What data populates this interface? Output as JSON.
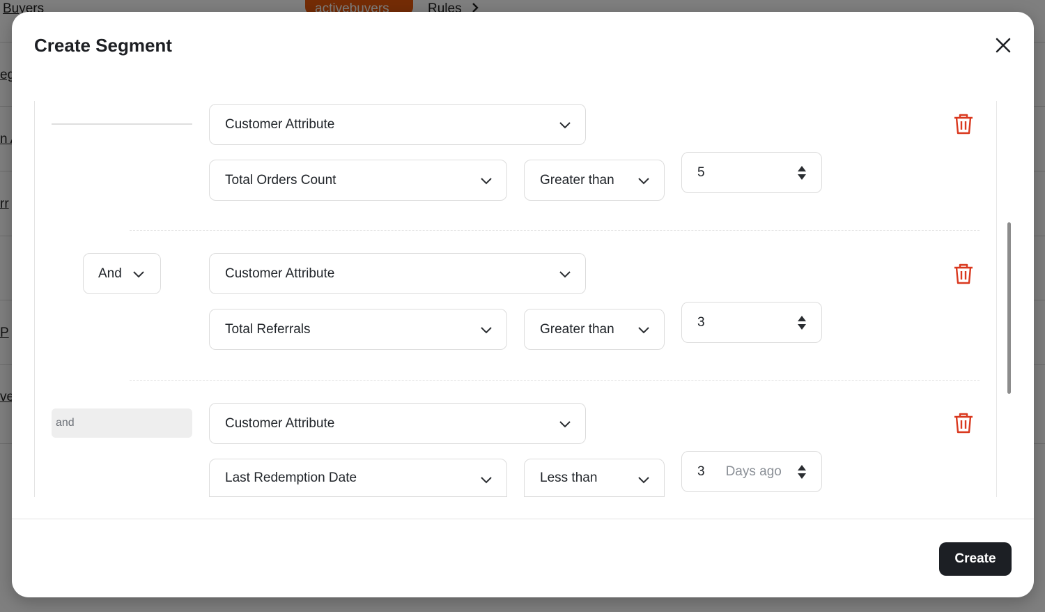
{
  "background": {
    "breadcrumb_left": "Buyers",
    "segment_pill": "activebuyers",
    "rules_label": "Rules",
    "row_fragments": [
      "eg",
      "n A",
      "rr",
      "",
      " P",
      "ve"
    ]
  },
  "modal": {
    "title": "Create Segment",
    "create_label": "Create"
  },
  "rules": [
    {
      "attribute_type": "Customer Attribute",
      "field": "Total Orders Count",
      "operator": "Greater than",
      "value": "5",
      "suffix": ""
    },
    {
      "connector": "And",
      "attribute_type": "Customer Attribute",
      "field": "Total Referrals",
      "operator": "Greater than",
      "value": "3",
      "suffix": ""
    },
    {
      "connector": "and",
      "attribute_type": "Customer Attribute",
      "field": "Last Redemption Date",
      "operator": "Less than",
      "value": "3",
      "suffix": "Days ago"
    }
  ],
  "colors": {
    "accent_dark": "#1c1f24",
    "danger": "#d9381e",
    "pill": "#e8590c"
  }
}
